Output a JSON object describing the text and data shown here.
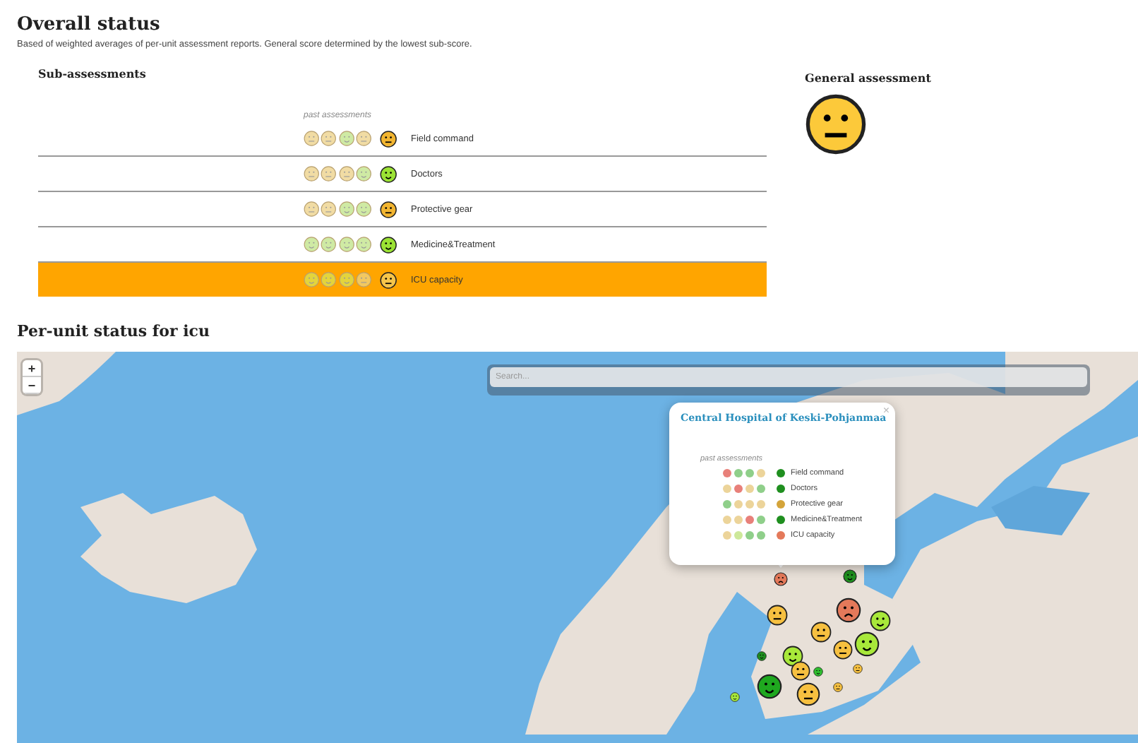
{
  "header": {
    "title": "Overall status",
    "description": "Based of weighted averages of per-unit assessment reports. General score determined by the lowest sub-score."
  },
  "sub_assessments": {
    "title": "Sub-assessments",
    "past_label": "past assessments",
    "rows": [
      {
        "label": "Field command",
        "selected": false,
        "past": [
          {
            "color": "#f1dca4",
            "kind": "neutral"
          },
          {
            "color": "#f1dca4",
            "kind": "neutral"
          },
          {
            "color": "#cfeaa4",
            "kind": "smile"
          },
          {
            "color": "#f1dca4",
            "kind": "neutral"
          }
        ],
        "current": {
          "color": "#f2b530",
          "kind": "neutral"
        }
      },
      {
        "label": "Doctors",
        "selected": false,
        "past": [
          {
            "color": "#f1dca4",
            "kind": "neutral"
          },
          {
            "color": "#f1dca4",
            "kind": "neutral"
          },
          {
            "color": "#f1dca4",
            "kind": "neutral"
          },
          {
            "color": "#cfeaa4",
            "kind": "smile"
          }
        ],
        "current": {
          "color": "#9be234",
          "kind": "smile"
        }
      },
      {
        "label": "Protective gear",
        "selected": false,
        "past": [
          {
            "color": "#f1dca4",
            "kind": "neutral"
          },
          {
            "color": "#f1dca4",
            "kind": "neutral"
          },
          {
            "color": "#cfeaa4",
            "kind": "smile"
          },
          {
            "color": "#cfeaa4",
            "kind": "smile"
          }
        ],
        "current": {
          "color": "#f2b530",
          "kind": "neutral"
        }
      },
      {
        "label": "Medicine&Treatment",
        "selected": false,
        "past": [
          {
            "color": "#cfeaa4",
            "kind": "smile"
          },
          {
            "color": "#cfeaa4",
            "kind": "smile"
          },
          {
            "color": "#cfeaa4",
            "kind": "smile"
          },
          {
            "color": "#cfeaa4",
            "kind": "smile"
          }
        ],
        "current": {
          "color": "#9be234",
          "kind": "smile"
        }
      },
      {
        "label": "ICU capacity",
        "selected": true,
        "past": [
          {
            "color": "#e3d43c",
            "kind": "smile"
          },
          {
            "color": "#e3d43c",
            "kind": "smile"
          },
          {
            "color": "#e3d43c",
            "kind": "smile"
          },
          {
            "color": "#f2c860",
            "kind": "neutral"
          }
        ],
        "current": {
          "color": "#f6c54a",
          "kind": "neutral"
        }
      }
    ]
  },
  "general_assessment": {
    "title": "General assessment",
    "current": {
      "color": "#fcc93a",
      "kind": "neutral"
    }
  },
  "per_unit": {
    "title": "Per-unit status for icu",
    "zoom_in": "+",
    "zoom_out": "−",
    "search": {
      "placeholder": "Search..."
    },
    "popup": {
      "title": "Central Hospital of Keski-Pohjanmaa",
      "close": "×",
      "past_label": "past assessments",
      "rows": [
        {
          "label": "Field command",
          "past": [
            {
              "color": "#e8807a"
            },
            {
              "color": "#8fcf8a"
            },
            {
              "color": "#8fcf8a"
            },
            {
              "color": "#ecd49a"
            }
          ],
          "current": {
            "color": "#1f8f1f"
          }
        },
        {
          "label": "Doctors",
          "past": [
            {
              "color": "#ecd49a"
            },
            {
              "color": "#e8807a"
            },
            {
              "color": "#ecd49a"
            },
            {
              "color": "#8fcf8a"
            }
          ],
          "current": {
            "color": "#1f8f1f"
          }
        },
        {
          "label": "Protective gear",
          "past": [
            {
              "color": "#8fcf8a"
            },
            {
              "color": "#ecd49a"
            },
            {
              "color": "#ecd49a"
            },
            {
              "color": "#ecd49a"
            }
          ],
          "current": {
            "color": "#d4a43a"
          }
        },
        {
          "label": "Medicine&Treatment",
          "past": [
            {
              "color": "#ecd49a"
            },
            {
              "color": "#ecd49a"
            },
            {
              "color": "#e8807a"
            },
            {
              "color": "#8fcf8a"
            }
          ],
          "current": {
            "color": "#1f8f1f"
          }
        },
        {
          "label": "ICU capacity",
          "past": [
            {
              "color": "#ecd49a"
            },
            {
              "color": "#cde89a"
            },
            {
              "color": "#8fcf8a"
            },
            {
              "color": "#8fcf8a"
            }
          ],
          "current": {
            "color": "#e4795a"
          }
        }
      ]
    },
    "markers": [
      {
        "color": "#e4795a",
        "kind": "frown"
      },
      {
        "color": "#1f8f1f",
        "kind": "smile"
      },
      {
        "color": "#f6c040",
        "kind": "neutral"
      },
      {
        "color": "#e4795a",
        "kind": "frown"
      },
      {
        "color": "#a8e83a",
        "kind": "smile"
      },
      {
        "color": "#f6c040",
        "kind": "neutral"
      },
      {
        "color": "#f6c040",
        "kind": "neutral"
      },
      {
        "color": "#a8e83a",
        "kind": "smile"
      },
      {
        "color": "#a8e83a",
        "kind": "smile"
      },
      {
        "color": "#1f8f1f",
        "kind": "smile"
      },
      {
        "color": "#f6c040",
        "kind": "neutral"
      },
      {
        "color": "#2fbf2f",
        "kind": "smile"
      },
      {
        "color": "#f6c040",
        "kind": "neutral"
      },
      {
        "color": "#1fa81f",
        "kind": "smile"
      },
      {
        "color": "#f6c040",
        "kind": "neutral"
      },
      {
        "color": "#f6c040",
        "kind": "neutral"
      },
      {
        "color": "#a8e83a",
        "kind": "smile"
      }
    ]
  }
}
